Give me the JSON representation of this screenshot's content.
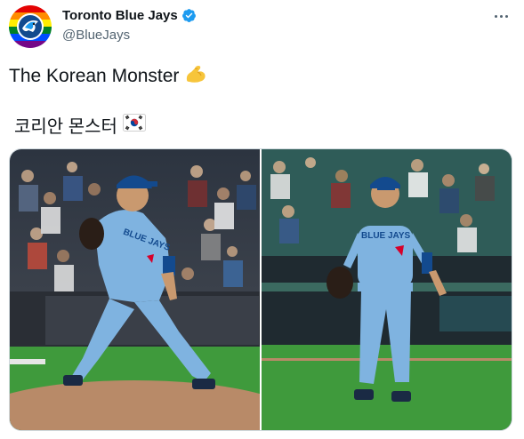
{
  "tweet": {
    "display_name": "Toronto Blue Jays",
    "handle": "@BlueJays",
    "line1": "The Korean Monster",
    "line1_emoji": "flexed-biceps",
    "line2": "코리안 몬스터",
    "line2_emoji": "south-korea-flag"
  },
  "icons": {
    "verified": "verified-badge-icon",
    "more": "more-options-icon"
  },
  "media": {
    "photos": [
      {
        "name": "pitcher-delivery-photo",
        "jersey_text": "BLUE JAYS"
      },
      {
        "name": "pitcher-walking-photo",
        "jersey_text": "BLUE JAYS"
      }
    ]
  },
  "colors": {
    "verified_blue": "#1d9bf0",
    "jersey_blue": "#7fb3e0",
    "grass_green": "#3f9a3c",
    "text_primary": "#0f1419",
    "text_secondary": "#536471"
  }
}
